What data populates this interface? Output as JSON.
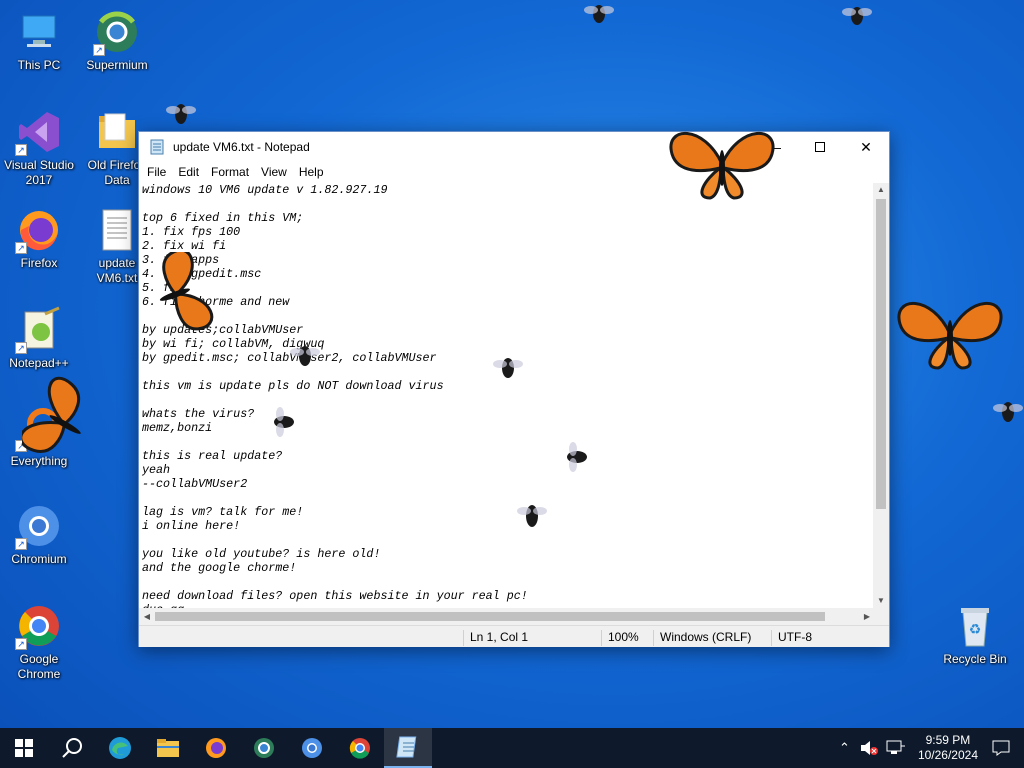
{
  "desktop": {
    "icons": [
      {
        "label": "This PC",
        "icon": "this-pc-icon"
      },
      {
        "label": "Supermium",
        "icon": "supermium-icon"
      },
      {
        "label": "Visual Studio 2017",
        "icon": "visual-studio-icon"
      },
      {
        "label": "Old Firefox Data",
        "icon": "folder-icon"
      },
      {
        "label": "Firefox",
        "icon": "firefox-icon"
      },
      {
        "label": "update VM6.txt",
        "icon": "text-file-icon"
      },
      {
        "label": "Notepad++",
        "icon": "notepad-plus-plus-icon"
      },
      {
        "label": "Everything",
        "icon": "everything-icon"
      },
      {
        "label": "Chromium",
        "icon": "chromium-icon"
      },
      {
        "label": "Google Chrome",
        "icon": "chrome-icon"
      },
      {
        "label": "Recycle Bin",
        "icon": "recycle-bin-icon"
      }
    ]
  },
  "notepad": {
    "title": "update VM6.txt - Notepad",
    "menu": [
      "File",
      "Edit",
      "Format",
      "View",
      "Help"
    ],
    "content": "windows 10 VM6 update v 1.82.927.19\n\ntop 6 fixed in this VM;\n1. fix fps 100\n2. fix wi fi\n3. fix apps\n4. fix gpedit.msc\n5. fix\n6. fix chorme and new\n\nby updates;collabVMUser\nby wi fi; collabVM, digwuq\nby gpedit.msc; collabVMUser2, collabVMUser\n\nthis vm is update pls do NOT download virus\n\nwhats the virus?\nmemz,bonzi\n\nthis is real update?\nyeah\n--collabVMUser2\n\nlag is vm? talk for me!\ni online here!\n\nyou like old youtube? is here old!\nand the google chorme!\n\nneed download files? open this website in your real pc!\nduo.gg",
    "status": {
      "position": "Ln 1, Col 1",
      "zoom": "100%",
      "line_ending": "Windows (CRLF)",
      "encoding": "UTF-8"
    }
  },
  "taskbar": {
    "items": [
      "start-icon",
      "search-icon",
      "edge-icon",
      "file-explorer-icon",
      "firefox-icon",
      "supermium-icon",
      "chromium-icon",
      "chrome-icon",
      "notepad-icon"
    ],
    "time": "9:59 PM",
    "date": "10/26/2024"
  },
  "colors": {
    "desktop": "#1268d4",
    "taskbar": "#0e1a2b",
    "butterfly": "#e8781a"
  }
}
